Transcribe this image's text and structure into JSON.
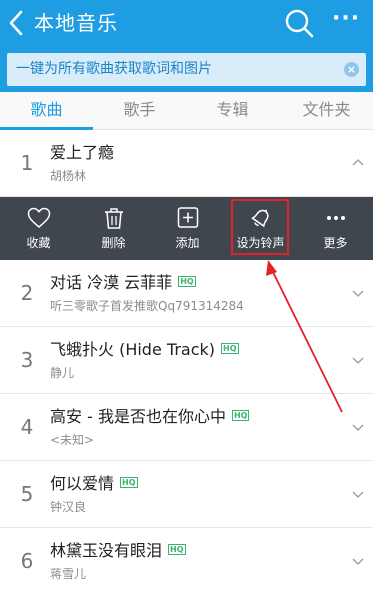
{
  "header": {
    "title": "本地音乐",
    "back_icon": "chevron-left-icon",
    "search_icon": "search-icon",
    "more_label": "···"
  },
  "notice": {
    "text": "一键为所有歌曲获取歌词和图片",
    "close_label": "×"
  },
  "tabs": [
    {
      "label": "歌曲",
      "active": true
    },
    {
      "label": "歌手",
      "active": false
    },
    {
      "label": "专辑",
      "active": false
    },
    {
      "label": "文件夹",
      "active": false
    }
  ],
  "songs": [
    {
      "index": "1",
      "title": "爱上了瘾",
      "hq": false,
      "artist": "胡杨林",
      "expanded": true
    },
    {
      "index": "2",
      "title": "对话 冷漠 云菲菲",
      "hq": true,
      "artist": "听三零歌子首发推歌Qq791314284",
      "expanded": false
    },
    {
      "index": "3",
      "title": "飞蛾扑火 (Hide Track)",
      "hq": true,
      "artist": "静儿",
      "expanded": false
    },
    {
      "index": "4",
      "title": "高安 - 我是否也在你心中",
      "hq": true,
      "artist": "<未知>",
      "expanded": false
    },
    {
      "index": "5",
      "title": "何以爱情",
      "hq": true,
      "artist": "钟汉良",
      "expanded": false
    },
    {
      "index": "6",
      "title": "林黛玉没有眼泪",
      "hq": true,
      "artist": "蒋雪儿",
      "expanded": false
    }
  ],
  "hq_label": "HQ",
  "actions": [
    {
      "label": "收藏",
      "icon": "heart-icon"
    },
    {
      "label": "删除",
      "icon": "trash-icon"
    },
    {
      "label": "添加",
      "icon": "add-box-icon"
    },
    {
      "label": "设为铃声",
      "icon": "bell-icon",
      "highlighted": true
    },
    {
      "label": "更多",
      "icon": "more-dots-icon"
    }
  ],
  "colors": {
    "brand": "#1e9de3",
    "action_bar": "#40464d",
    "highlight": "#e4202a",
    "hq": "#3cb371"
  }
}
